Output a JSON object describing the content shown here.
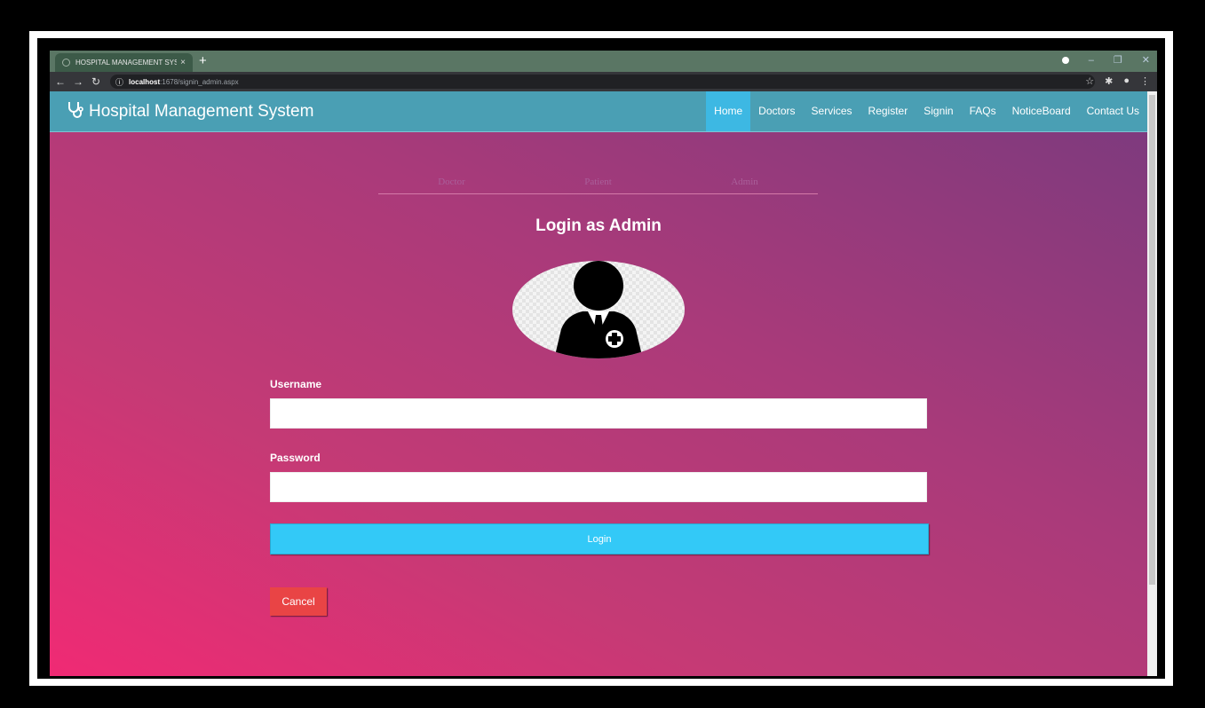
{
  "browser": {
    "tab_title": "HOSPITAL MANAGEMENT SYSTE",
    "tab_close": "×",
    "new_tab": "+",
    "url_host": "localhost",
    "url_path": ":1678/signin_admin.aspx"
  },
  "navbar": {
    "brand": "Hospital Management System",
    "links": [
      "Home",
      "Doctors",
      "Services",
      "Register",
      "Signin",
      "FAQs",
      "NoticeBoard",
      "Contact Us"
    ],
    "active": "Home"
  },
  "role_tabs": [
    "Doctor",
    "Patient",
    "Admin"
  ],
  "login": {
    "title": "Login as Admin",
    "username_label": "Username",
    "username_value": "",
    "password_label": "Password",
    "password_value": "",
    "login_button": "Login",
    "cancel_button": "Cancel"
  },
  "icons": {
    "brand": "stethoscope-icon",
    "avatar": "doctor-avatar-icon"
  },
  "colors": {
    "navbar": "#4a9fb4",
    "active_link": "#3db8e3",
    "login_button": "#33c9f7",
    "cancel_button": "#e94445"
  }
}
